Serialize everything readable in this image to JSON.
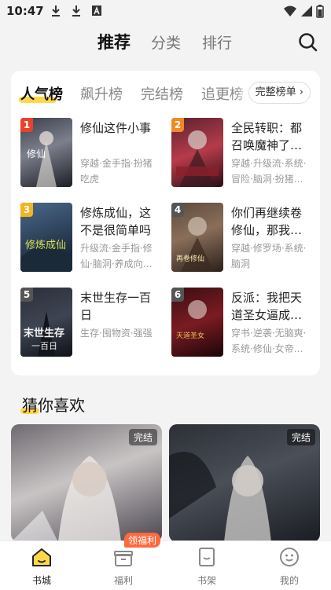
{
  "status": {
    "time": "10:47",
    "left_icons": [
      "download-icon",
      "download-icon",
      "text-app-icon"
    ],
    "right_icons": [
      "wifi-icon",
      "signal-icon",
      "battery-icon"
    ]
  },
  "top_tabs": [
    {
      "label": "推荐",
      "active": true
    },
    {
      "label": "分类",
      "active": false
    },
    {
      "label": "排行",
      "active": false
    }
  ],
  "ranking": {
    "tabs": [
      {
        "label": "人气榜",
        "active": true
      },
      {
        "label": "飙升榜",
        "active": false
      },
      {
        "label": "完结榜",
        "active": false
      },
      {
        "label": "追更榜",
        "active": false
      }
    ],
    "full_list_label": "完整榜单",
    "books": [
      {
        "rank": "1",
        "title": "修仙这件小事",
        "tags": "穿越·金手指·扮猪吃虎",
        "badge_color": "#e8412c"
      },
      {
        "rank": "2",
        "title": "全民转职：都召唤魔神了…",
        "tags": "穿越·升级流·系统·冒险·脑洞·扮猪…",
        "badge_color": "#f08a24"
      },
      {
        "rank": "3",
        "title": "修炼成仙，这不是很简单吗",
        "tags": "升级流·金手指·修仙·脑洞·养成向…",
        "badge_color": "#f2b51f"
      },
      {
        "rank": "4",
        "title": "你们再继续卷修仙，那我…",
        "tags": "穿越·修罗场·系统·脑洞",
        "badge_color": "#555555"
      },
      {
        "rank": "5",
        "title": "末世生存一百日",
        "tags": "生存·囤物资·强强",
        "badge_color": "#555555"
      },
      {
        "rank": "6",
        "title": "反派：我把天道圣女逼成…",
        "tags": "穿书·逆袭·无脑爽·系统·修仙·女帝…",
        "badge_color": "#555555"
      }
    ]
  },
  "guess_section": {
    "title": "猜你喜欢",
    "items": [
      {
        "badge": "完结"
      },
      {
        "badge": "完结"
      }
    ]
  },
  "bottom_nav": {
    "items": [
      {
        "label": "书城",
        "icon": "home-icon",
        "active": true
      },
      {
        "label": "福利",
        "icon": "gift-icon",
        "active": false
      },
      {
        "label": "书架",
        "icon": "bookshelf-icon",
        "active": false
      },
      {
        "label": "我的",
        "icon": "profile-icon",
        "active": false
      }
    ],
    "welfare_badge": "领福利"
  },
  "colors": {
    "accent": "#ffd84a",
    "badge_orange": "#ff6a3d"
  }
}
